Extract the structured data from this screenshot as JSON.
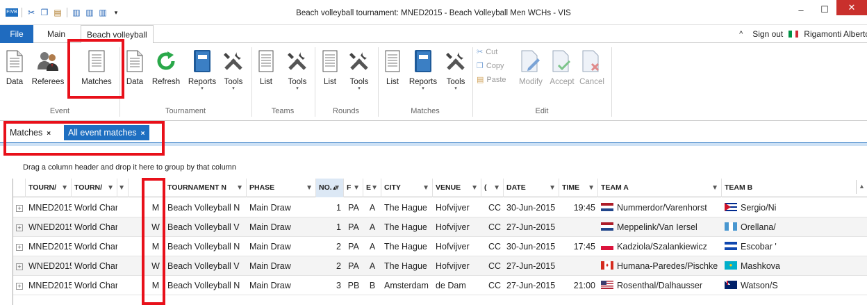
{
  "window": {
    "title": "Beach volleyball tournament: MNED2015 - Beach Volleyball Men WCHs - VIS",
    "app_icon": "FIVB"
  },
  "tabs": {
    "file": "File",
    "main": "Main",
    "beach": "Beach volleyball"
  },
  "user": {
    "sign_out": "Sign out",
    "name": "Rigamonti Alberto",
    "chevron": "^"
  },
  "ribbon": {
    "event": {
      "label": "Event",
      "data": "Data",
      "referees": "Referees",
      "matches": "Matches"
    },
    "tournament": {
      "label": "Tournament",
      "data": "Data",
      "refresh": "Refresh",
      "reports": "Reports",
      "tools": "Tools"
    },
    "teams": {
      "label": "Teams",
      "list": "List",
      "tools": "Tools"
    },
    "rounds": {
      "label": "Rounds",
      "list": "List",
      "tools": "Tools"
    },
    "matches": {
      "label": "Matches",
      "list": "List",
      "reports": "Reports",
      "tools": "Tools"
    },
    "edit": {
      "label": "Edit",
      "cut": "Cut",
      "copy": "Copy",
      "paste": "Paste",
      "modify": "Modify",
      "accept": "Accept",
      "cancel": "Cancel"
    }
  },
  "doc_tabs": [
    {
      "label": "Matches",
      "close": "×"
    },
    {
      "label": "All event matches",
      "close": "×"
    }
  ],
  "grid": {
    "group_hint": "Drag a column header and drop it here to group by that column",
    "headers": {
      "tourn_code": "TOURN/",
      "tourn_name": "TOURN/",
      "gender": "",
      "tournament_name": "TOURNAMENT N",
      "phase": "PHASE",
      "no": "NO.",
      "f": "F",
      "e": "E",
      "city": "CITY",
      "venue": "VENUE",
      "c": "(",
      "date": "DATE",
      "time": "TIME",
      "team_a": "TEAM A",
      "team_b": "TEAM B"
    },
    "rows": [
      {
        "code": "MNED2015",
        "tname": "World Char",
        "gender": "M",
        "tournament": "Beach Volleyball N",
        "phase": "Main Draw",
        "no": "1",
        "f": "PA",
        "e": "A",
        "city": "The Hague",
        "venue": "Hofvijver",
        "c": "CC",
        "date": "30-Jun-2015",
        "time": "19:45",
        "team_a": "Nummerdor/Varenhorst",
        "flag_a": "nl",
        "team_b": "Sergio/Ni",
        "flag_b": "cu"
      },
      {
        "code": "WNED2015",
        "tname": "World Char",
        "gender": "W",
        "tournament": "Beach Volleyball V",
        "phase": "Main Draw",
        "no": "1",
        "f": "PA",
        "e": "A",
        "city": "The Hague",
        "venue": "Hofvijver",
        "c": "CC",
        "date": "27-Jun-2015",
        "time": "",
        "team_a": "Meppelink/Van Iersel",
        "flag_a": "nl",
        "team_b": "Orellana/",
        "flag_b": "gt"
      },
      {
        "code": "MNED2015",
        "tname": "World Char",
        "gender": "M",
        "tournament": "Beach Volleyball N",
        "phase": "Main Draw",
        "no": "2",
        "f": "PA",
        "e": "A",
        "city": "The Hague",
        "venue": "Hofvijver",
        "c": "CC",
        "date": "30-Jun-2015",
        "time": "17:45",
        "team_a": "Kadziola/Szalankiewicz",
        "flag_a": "pl",
        "team_b": "Escobar '",
        "flag_b": "sv"
      },
      {
        "code": "WNED2015",
        "tname": "World Char",
        "gender": "W",
        "tournament": "Beach Volleyball V",
        "phase": "Main Draw",
        "no": "2",
        "f": "PA",
        "e": "A",
        "city": "The Hague",
        "venue": "Hofvijver",
        "c": "CC",
        "date": "27-Jun-2015",
        "time": "",
        "team_a": "Humana-Paredes/Pischke",
        "flag_a": "ca",
        "team_b": "Mashkova",
        "flag_b": "kz"
      },
      {
        "code": "MNED2015",
        "tname": "World Char",
        "gender": "M",
        "tournament": "Beach Volleyball N",
        "phase": "Main Draw",
        "no": "3",
        "f": "PB",
        "e": "B",
        "city": "Amsterdam",
        "venue": "de Dam",
        "c": "CC",
        "date": "27-Jun-2015",
        "time": "21:00",
        "team_a": "Rosenthal/Dalhausser",
        "flag_a": "us",
        "team_b": "Watson/S",
        "flag_b": "au"
      }
    ]
  },
  "colors": {
    "accent": "#1e6fc1",
    "highlight": "#e8101a"
  }
}
